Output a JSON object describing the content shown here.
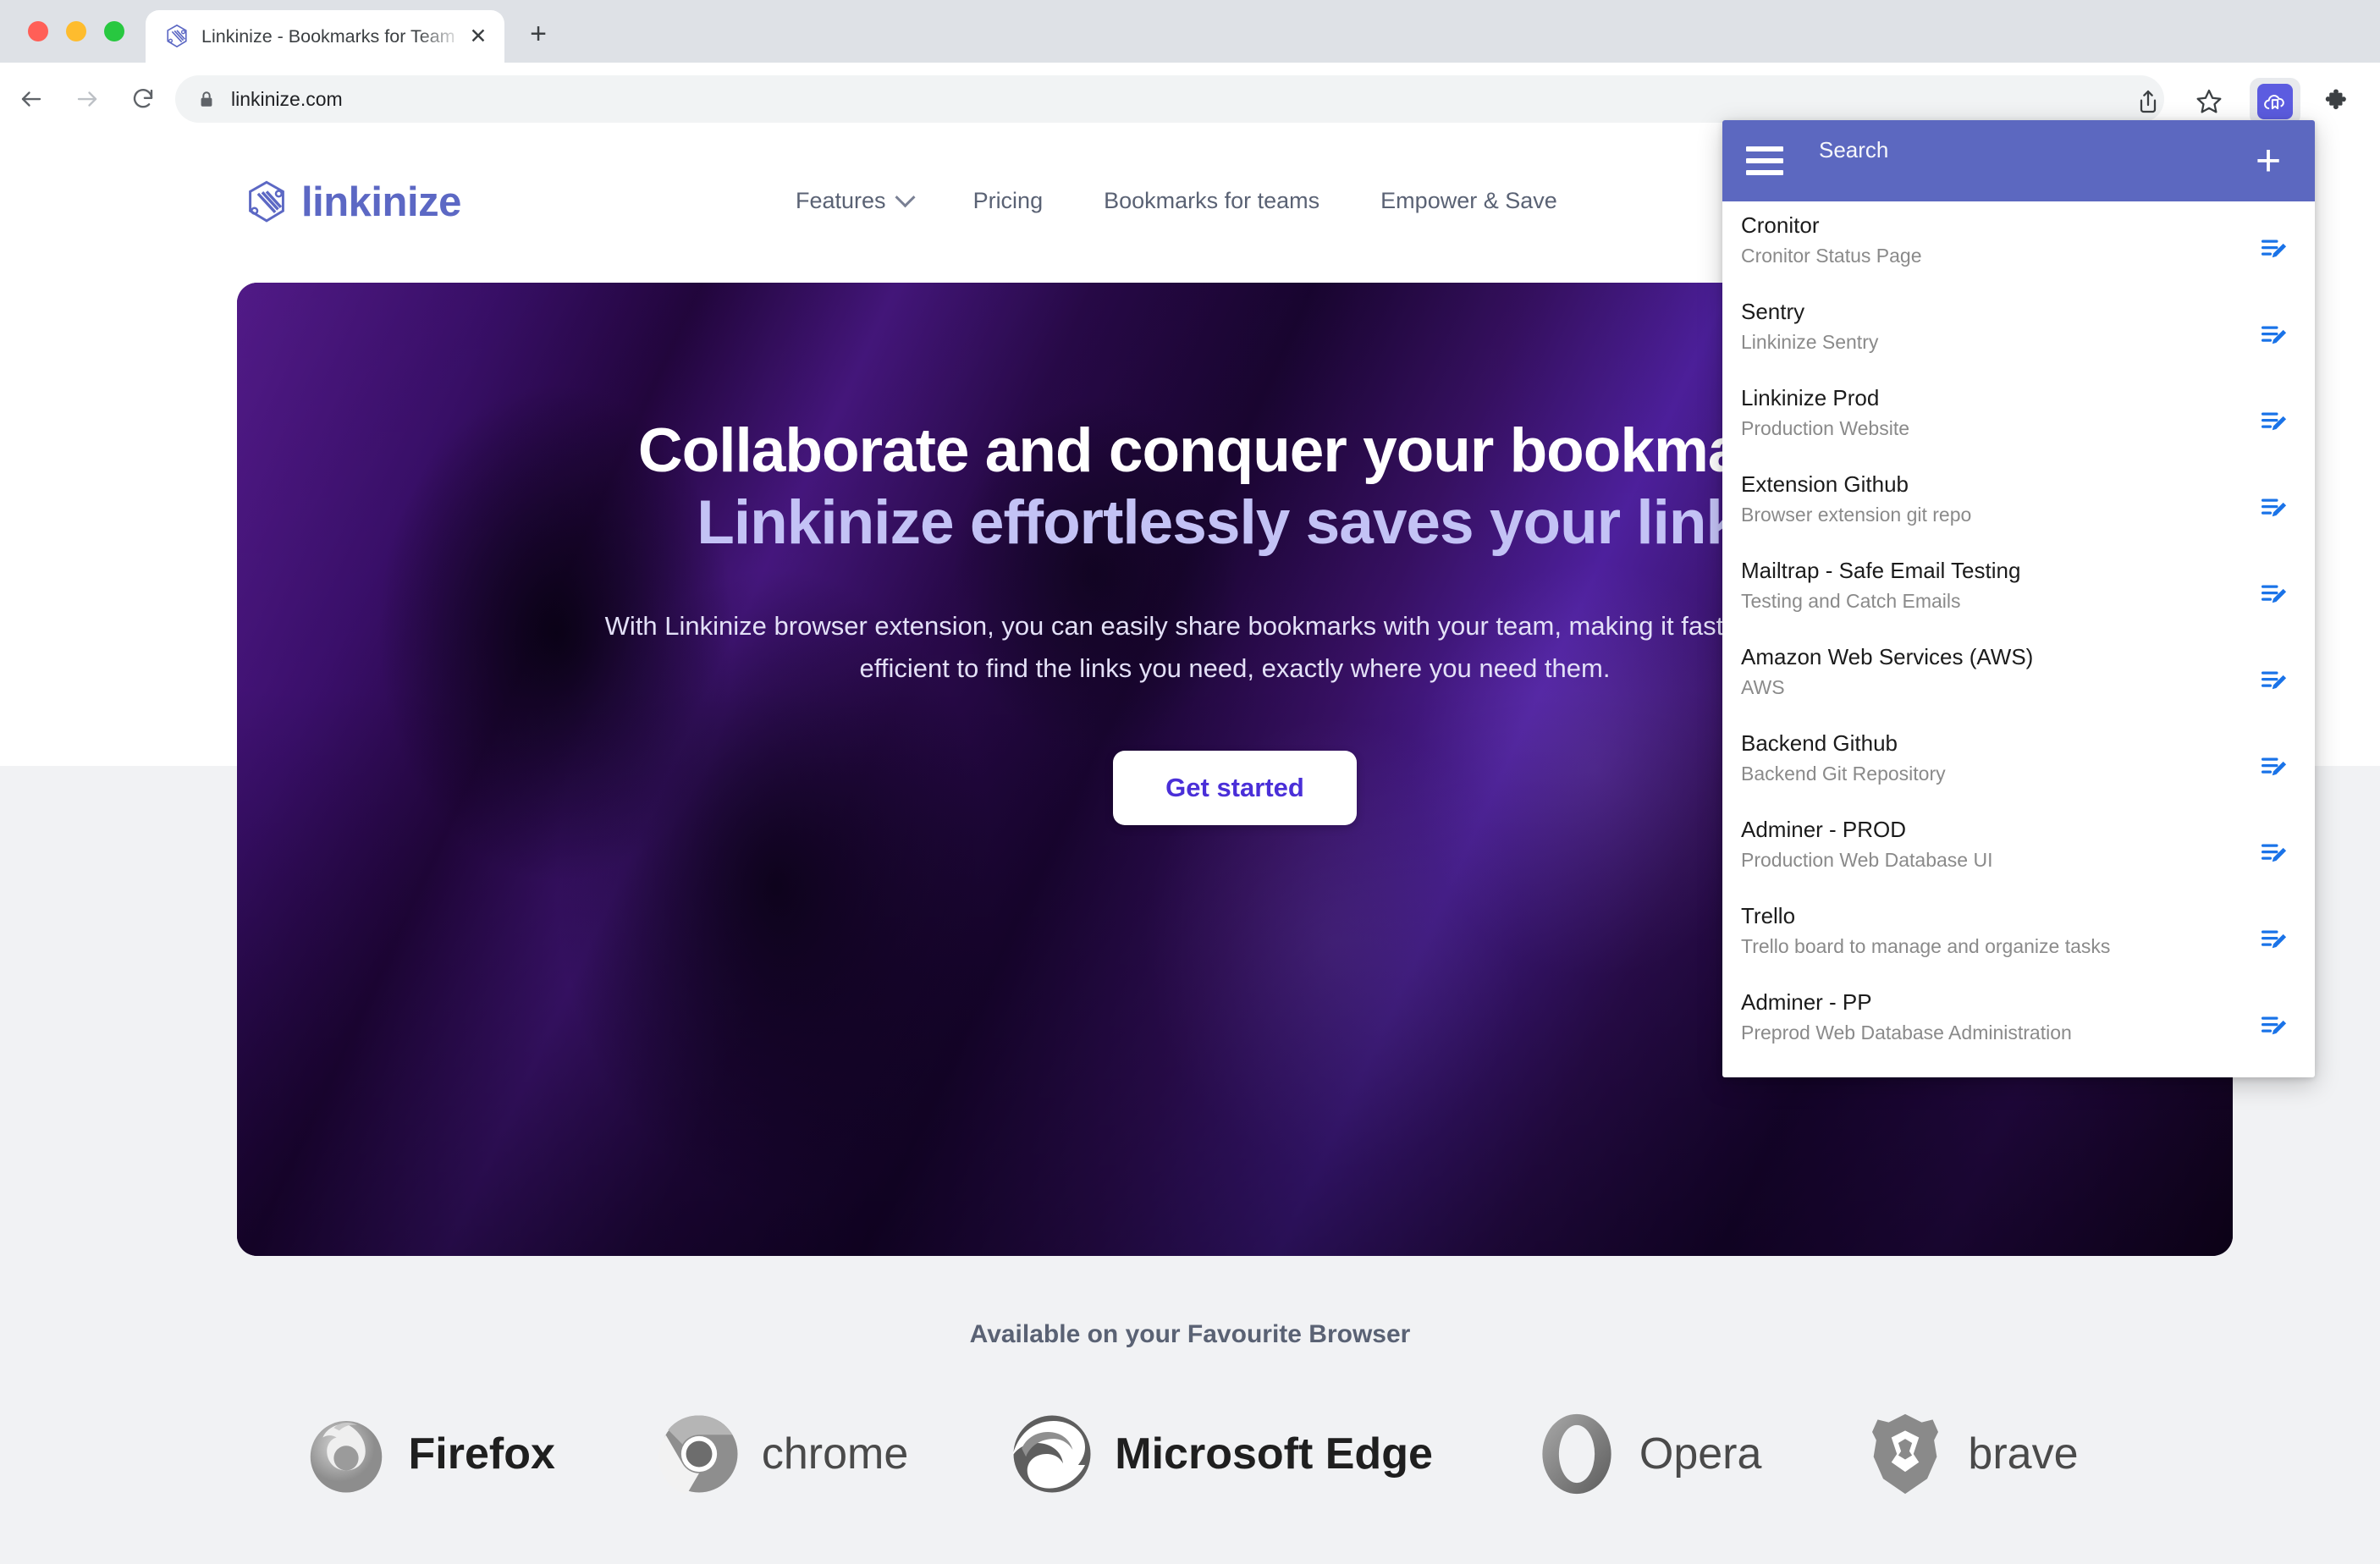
{
  "browser": {
    "tab": {
      "title": "Linkinize - Bookmarks for Team",
      "favicon": "linkinize-logo-icon",
      "close_label": "✕"
    },
    "new_tab_label": "+",
    "nav": {
      "back": "back-arrow-icon",
      "forward": "forward-arrow-icon",
      "reload": "reload-icon"
    },
    "omnibox": {
      "url": "linkinize.com",
      "lock": "lock-icon"
    },
    "actions": {
      "share": "share-icon",
      "bookmark_star": "star-icon",
      "extension_linkinize": "linkinize-cloud-bookmark-icon",
      "extensions_puzzle": "puzzle-piece-icon"
    }
  },
  "site": {
    "brand": {
      "name": "linkinize",
      "mark": "linkinize-hexagon-logo"
    },
    "nav": [
      {
        "label": "Features",
        "has_dropdown": true
      },
      {
        "label": "Pricing",
        "has_dropdown": false
      },
      {
        "label": "Bookmarks for teams",
        "has_dropdown": false
      },
      {
        "label": "Empower & Save",
        "has_dropdown": false
      }
    ],
    "hero": {
      "heading_line1": "Collaborate and conquer your bookmarks",
      "heading_line2": "Linkinize effortlessly saves your links",
      "subtext": "With Linkinize browser extension, you can easily share bookmarks with your team, making it faster and more efficient to find the links you need, exactly where you need them.",
      "cta_label": "Get started"
    },
    "browsers": {
      "title": "Available on your Favourite Browser",
      "items": [
        {
          "label": "Firefox",
          "icon": "firefox-logo",
          "weight": "bold"
        },
        {
          "label": "chrome",
          "icon": "chrome-logo",
          "weight": "thin"
        },
        {
          "label": "Microsoft Edge",
          "icon": "edge-logo",
          "weight": "bold"
        },
        {
          "label": "Opera",
          "icon": "opera-logo",
          "weight": "thin"
        },
        {
          "label": "brave",
          "icon": "brave-logo",
          "weight": "thin"
        }
      ]
    }
  },
  "extension_popup": {
    "header": {
      "menu_icon": "hamburger-menu-icon",
      "search_placeholder": "Search",
      "add_label": "+",
      "background_color": "#5c68c0"
    },
    "edit_icon_color": "#1a73e8",
    "bookmarks": [
      {
        "title": "Cronitor",
        "desc": "Cronitor Status Page"
      },
      {
        "title": "Sentry",
        "desc": "Linkinize Sentry"
      },
      {
        "title": "Linkinize Prod",
        "desc": "Production Website"
      },
      {
        "title": "Extension Github",
        "desc": "Browser extension git repo"
      },
      {
        "title": "Mailtrap - Safe Email Testing",
        "desc": "Testing and Catch Emails"
      },
      {
        "title": "Amazon Web Services (AWS)",
        "desc": "AWS"
      },
      {
        "title": "Backend Github",
        "desc": "Backend Git Repository"
      },
      {
        "title": "Adminer - PROD",
        "desc": "Production Web Database UI"
      },
      {
        "title": "Trello",
        "desc": "Trello board to manage and organize tasks"
      },
      {
        "title": "Adminer - PP",
        "desc": "Preprod Web Database Administration"
      }
    ]
  },
  "colors": {
    "brand_purple": "#5c68c4",
    "popup_header": "#5c68c0",
    "cta_text": "#4a2fd8",
    "extension_chip": "#5c5ce0"
  }
}
